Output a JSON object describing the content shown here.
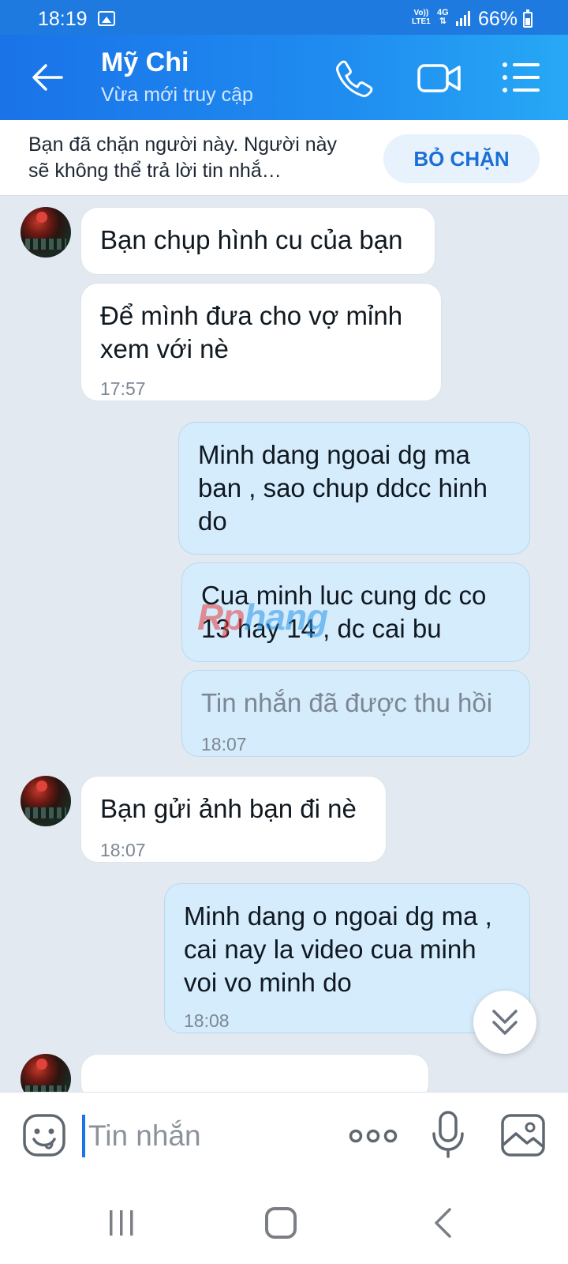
{
  "status_bar": {
    "time": "18:19",
    "volte_top": "Vo))",
    "volte_bottom": "LTE1",
    "network": "4G",
    "battery": "66%"
  },
  "header": {
    "contact_name": "Mỹ Chi",
    "contact_status": "Vừa mới truy cập",
    "icons": [
      "back-arrow-icon",
      "phone-icon",
      "video-camera-icon",
      "menu-list-icon"
    ]
  },
  "block_banner": {
    "text": "Bạn đã chặn người này. Người này sẽ không thể trả lời tin nhắ…",
    "unblock_label": "BỎ CHẶN"
  },
  "messages": [
    {
      "side": "in",
      "text": "Bạn chụp hình cu của bạn",
      "time": ""
    },
    {
      "side": "in",
      "text": "Để mình đưa cho vợ mỉnh xem với nè",
      "time": "17:57"
    },
    {
      "side": "out",
      "text": "Minh dang ngoai dg ma ban , sao chup ddcc hinh do",
      "time": ""
    },
    {
      "side": "out",
      "text": "Cua minh luc cung dc co 13 hay 14 , dc cai bu",
      "time": ""
    },
    {
      "side": "out",
      "text": "Tin nhắn đã được thu hồi",
      "time": "18:07",
      "recalled": true
    },
    {
      "side": "in",
      "text": "Bạn gửi ảnh bạn đi nè",
      "time": "18:07"
    },
    {
      "side": "out",
      "text": "Minh dang o ngoai dg ma , cai nay la video cua minh voi vo minh do",
      "time": "18:08"
    }
  ],
  "watermark": {
    "part1": "Rp",
    "part2": "hang"
  },
  "composer": {
    "placeholder": "Tin nhắn",
    "icons": [
      "emoji-icon",
      "more-dots-icon",
      "microphone-icon",
      "image-icon"
    ]
  },
  "colors": {
    "header_blue": "#1a73e8",
    "outgoing_bubble": "#d5ecfd",
    "incoming_bubble": "#ffffff",
    "chat_background": "#e2e9f1",
    "unblock_text": "#1a6fd6"
  }
}
